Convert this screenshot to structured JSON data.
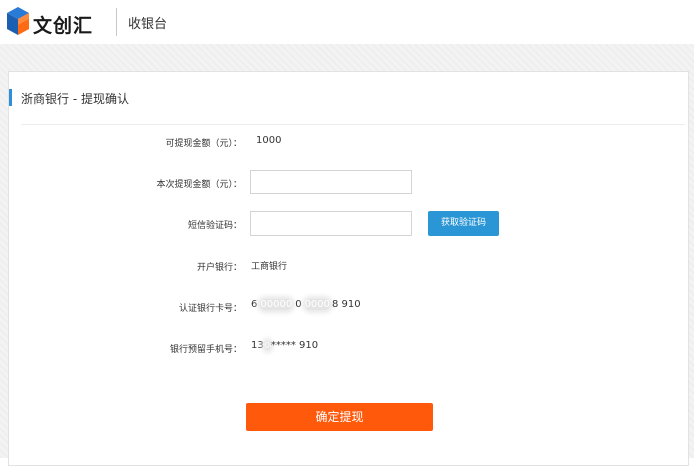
{
  "header": {
    "logo_text": "文创汇",
    "subtitle": "收银台"
  },
  "card": {
    "title": "浙商银行 - 提现确认"
  },
  "form": {
    "available_label": "可提现金额（元）：",
    "available_value": "1000",
    "amount_label": "本次提现金额（元）：",
    "amount_value": "",
    "sms_label": "短信验证码：",
    "sms_value": "",
    "get_code_label": "获取验证码",
    "bank_label": "开户银行：",
    "bank_value": "工商银行",
    "card_label": "认证银行卡号：",
    "card_value_prefix": "6",
    "card_value_mask1": "00000",
    "card_value_mid": "0",
    "card_value_mask2": "0000",
    "card_value_suffix": "8 910",
    "phone_label": "银行预留手机号：",
    "phone_value_prefix": "13",
    "phone_value_mask": "0",
    "phone_value_suffix": "***** 910",
    "confirm_label": "确定提现"
  },
  "colors": {
    "accent_blue": "#2a96d6",
    "confirm_orange": "#ff5a0c",
    "title_bar_blue": "#2f8fd8"
  },
  "icons": {
    "logo": "cube-logo-icon"
  }
}
